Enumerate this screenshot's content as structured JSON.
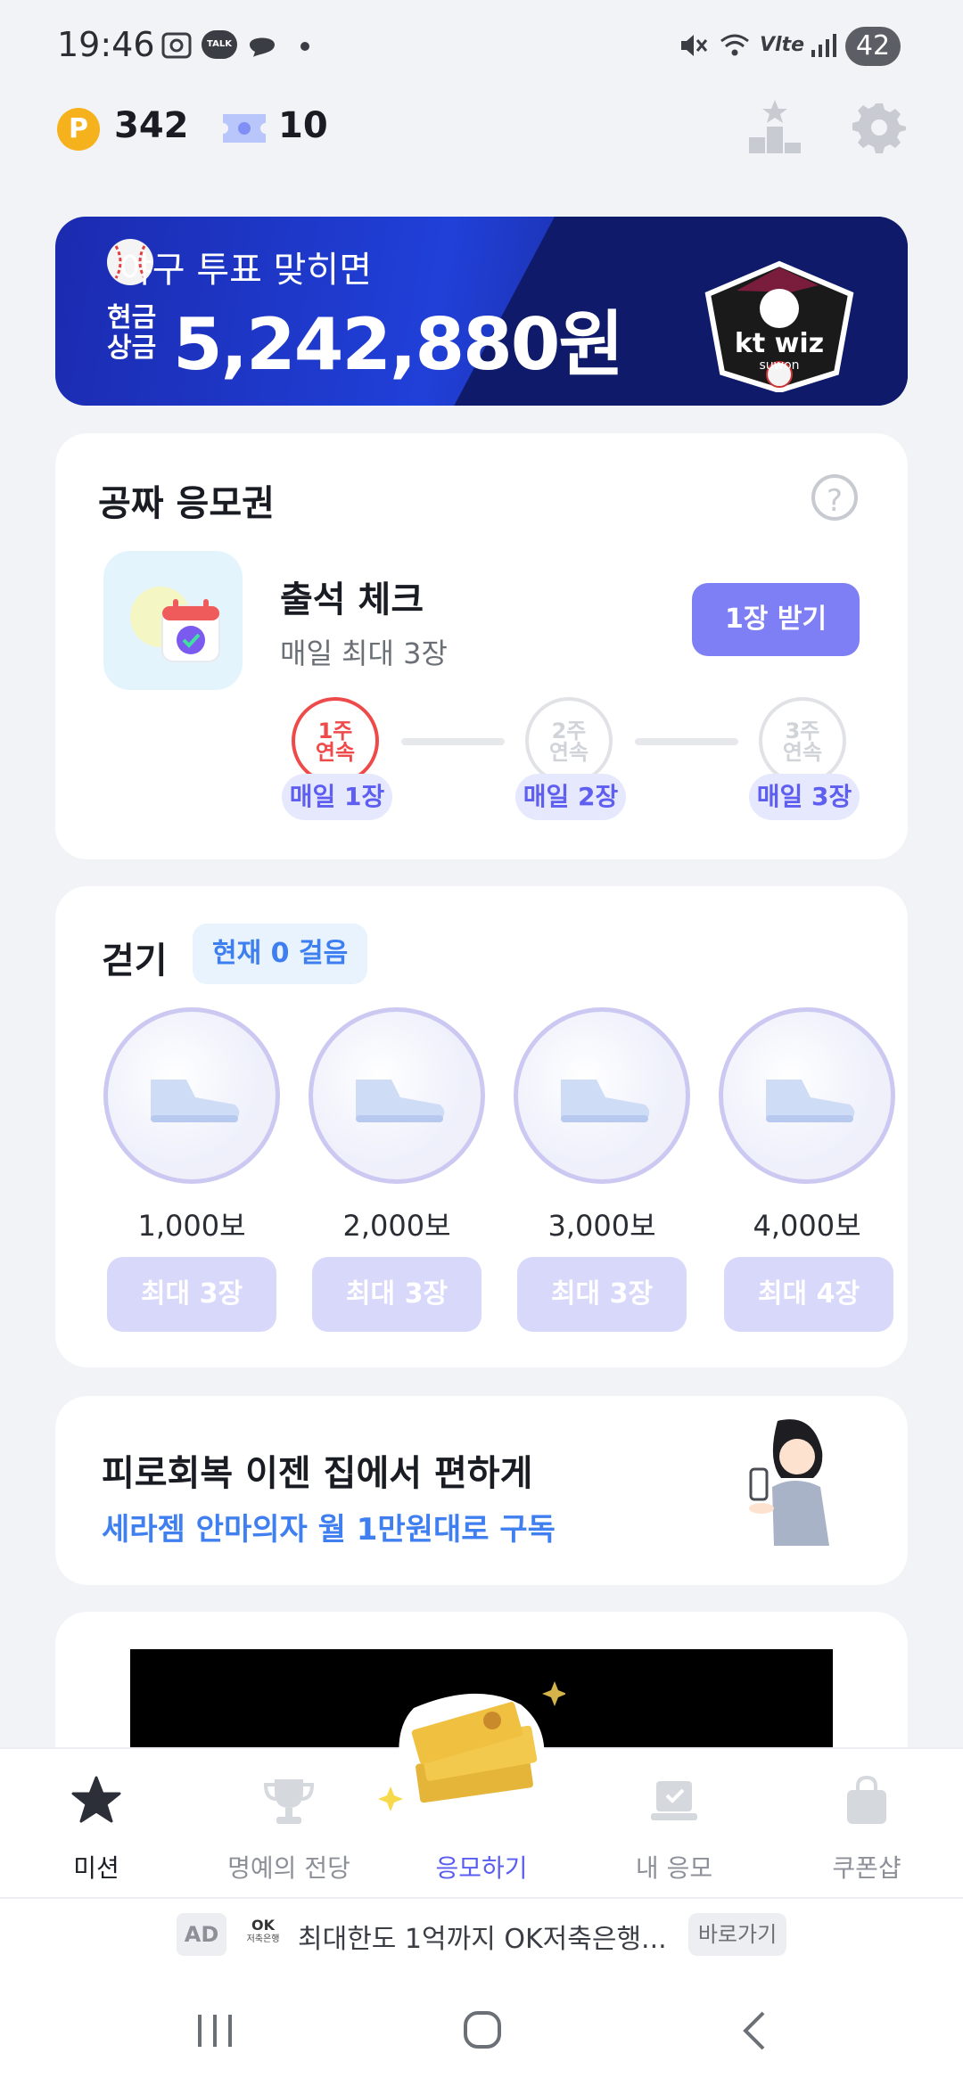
{
  "status_bar": {
    "time": "19:46",
    "battery": "42",
    "icons": [
      "screenshot-icon",
      "talk-icon",
      "chat-icon",
      "dot-icon",
      "mute-icon",
      "wifi-icon",
      "volte-icon",
      "signal-icon"
    ],
    "talk_text": "TALK",
    "volte_text": "Vlte"
  },
  "header": {
    "points_symbol": "P",
    "points": "342",
    "tickets": "10"
  },
  "banner": {
    "line1": "야구 투표 맞히면",
    "prefix_line1": "현금",
    "prefix_line2": "상금",
    "amount": "5,242,880원",
    "logo_text": "kt wiz",
    "logo_sub": "suwon",
    "colors": {
      "bg": "#1b2bb0",
      "dark": "#0f1b6a"
    }
  },
  "free_tickets": {
    "title": "공짜 응모권",
    "help": "?",
    "attendance": {
      "title": "출석 체크",
      "subtitle": "매일 최대 3장",
      "button": "1장 받기"
    },
    "streaks": [
      {
        "stamp_line1": "1주",
        "stamp_line2": "연속",
        "label": "매일 1장",
        "active": true
      },
      {
        "stamp_line1": "2주",
        "stamp_line2": "연속",
        "label": "매일 2장",
        "active": false
      },
      {
        "stamp_line1": "3주",
        "stamp_line2": "연속",
        "label": "매일 3장",
        "active": false
      }
    ]
  },
  "walking": {
    "title": "걷기",
    "badge": "현재 0 걸음",
    "goals": [
      {
        "steps": "1,000보",
        "button": "최대 3장"
      },
      {
        "steps": "2,000보",
        "button": "최대 3장"
      },
      {
        "steps": "3,000보",
        "button": "최대 3장"
      },
      {
        "steps": "4,000보",
        "button": "최대 4장"
      }
    ]
  },
  "ad_card": {
    "title": "피로회복 이젠 집에서 편하게",
    "subtitle": "세라젬 안마의자 월 1만원대로 구독"
  },
  "bottom_nav": {
    "items": [
      {
        "label": "미션",
        "icon": "star-icon"
      },
      {
        "label": "명예의 전당",
        "icon": "trophy-icon"
      },
      {
        "label": "응모하기",
        "icon": "money-stack-icon"
      },
      {
        "label": "내 응모",
        "icon": "laptop-check-icon"
      },
      {
        "label": "쿠폰샵",
        "icon": "shopping-bag-icon"
      }
    ]
  },
  "ad_strip": {
    "tag": "AD",
    "logo_line1": "OK",
    "logo_line2": "저축은행",
    "text": "최대한도 1억까지 OK저축은행...",
    "action": "바로가기"
  }
}
